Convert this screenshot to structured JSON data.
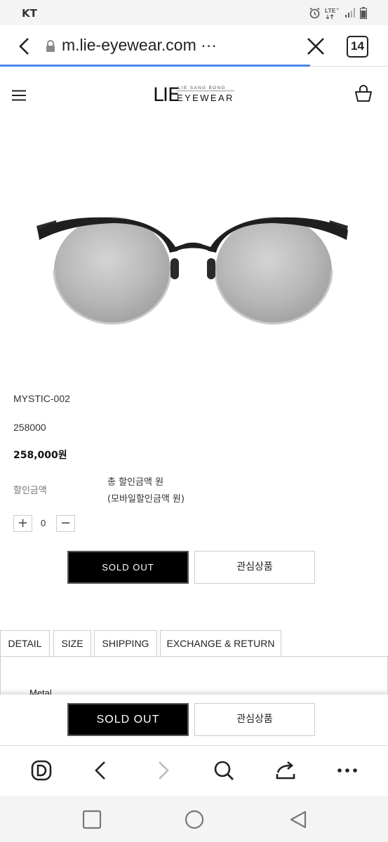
{
  "status_bar": {
    "carrier": "KT"
  },
  "browser": {
    "url": "m.lie-eyewear.com ···",
    "tab_count": "14",
    "load_progress": 0.8
  },
  "site": {
    "logo_text": "LIE",
    "logo_subtitle": "LIE SANG BONG",
    "logo_brand": "EYEWEAR"
  },
  "product": {
    "name": "MYSTIC-002",
    "code_price": "258000",
    "price": "258,000원",
    "discount_label": "할인금액",
    "discount_total": "총 할인금액 원",
    "discount_mobile": "(모바일할인금액 원)",
    "quantity": "0",
    "qty_plus": "+",
    "qty_minus": "−",
    "sold_out_label": "SOLD OUT",
    "wishlist_label": "관심상품"
  },
  "tabs": [
    {
      "label": "DETAIL"
    },
    {
      "label": "SIZE"
    },
    {
      "label": "SHIPPING"
    },
    {
      "label": "EXCHANGE & RETURN"
    }
  ],
  "detail": {
    "material": "Metal"
  },
  "sticky": {
    "sold_out_label": "SOLD OUT",
    "wishlist_label": "관심상품"
  }
}
